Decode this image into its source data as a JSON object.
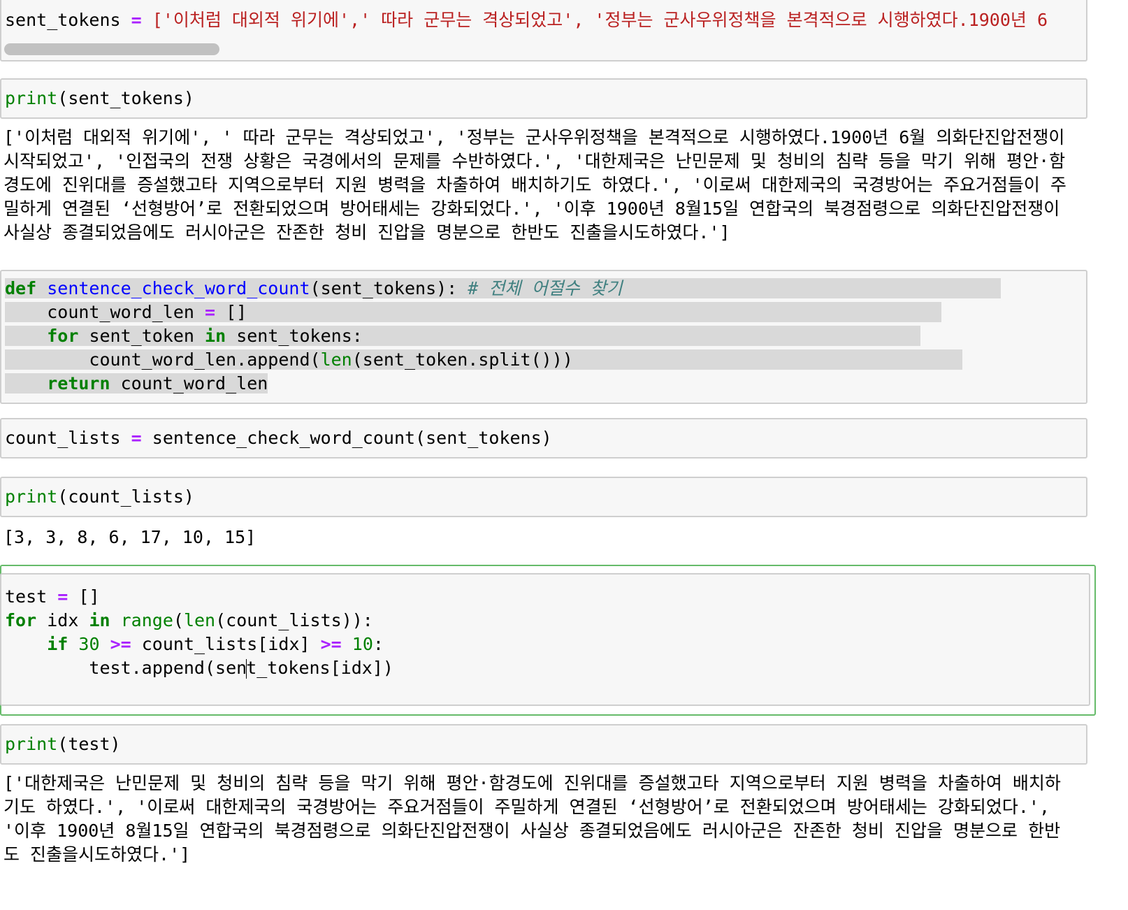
{
  "cell1": {
    "code_var": "sent_tokens",
    "eq": "=",
    "code_values": "['이처럼 대외적 위기에',' 따라 군무는 격상되었고', '정부는 군사우위정책을 본격적으로 시행하였다.1900년 6"
  },
  "cell2": {
    "code_fn": "print",
    "code_args": "(sent_tokens)",
    "output": "['이처럼 대외적 위기에', ' 따라 군무는 격상되었고', '정부는 군사우위정책을 본격적으로 시행하였다.1900년 6월 의화단진압전쟁이 시작되었고', '인접국의 전쟁 상황은 국경에서의 문제를 수반하였다.', '대한제국은 난민문제 및 청비의 침략 등을 막기 위해 평안·함경도에 진위대를 증설했고타 지역으로부터 지원 병력을 차출하여 배치하기도 하였다.', '이로써 대한제국의 국경방어는 주요거점들이 주밀하게 연결된 ‘선형방어’로 전환되었으며 방어태세는 강화되었다.', '이후 1900년 8월15일 연합국의 북경점령으로 의화단진압전쟁이 사실상 종결되었음에도 러시아군은 잔존한 청비 진압을 명분으로 한반도 진출을시도하였다.']"
  },
  "cell3": {
    "kw_def": "def",
    "fn_name": "sentence_check_word_count",
    "params": "(sent_tokens):",
    "comment": "# 전체 어절수 찾기",
    "l2_var": "count_word_len",
    "l2_eq": "=",
    "l2_val": "[]",
    "kw_for": "for",
    "l3_var": "sent_token",
    "kw_in": "in",
    "l3_iter": "sent_tokens:",
    "l4_a": "count_word_len.append(",
    "l4_len": "len",
    "l4_b": "(sent_token.split()))",
    "kw_return": "return",
    "l5_val": "count_word_len"
  },
  "cell4": {
    "var": "count_lists",
    "eq": "=",
    "rhs": "sentence_check_word_count(sent_tokens)"
  },
  "cell5": {
    "code_fn": "print",
    "code_args": "(count_lists)",
    "output": "[3, 3, 8, 6, 17, 10, 15]"
  },
  "cell6": {
    "l1_var": "test",
    "l1_eq": "=",
    "l1_val": "[]",
    "kw_for": "for",
    "l2_var": "idx",
    "kw_in": "in",
    "l2_range": "range",
    "l2_p1": "(",
    "l2_len": "len",
    "l2_p2": "(count_lists)):",
    "kw_if": "if",
    "l3_num1": "30",
    "l3_op1": ">=",
    "l3_mid": "count_lists[idx]",
    "l3_op2": ">=",
    "l3_num2": "10",
    "l3_colon": ":",
    "l4_a": "test.append(sen",
    "l4_b": "t_tokens[idx])"
  },
  "cell7": {
    "code_fn": "print",
    "code_args": "(test)",
    "output": "['대한제국은 난민문제 및 청비의 침략 등을 막기 위해 평안·함경도에 진위대를 증설했고타 지역으로부터 지원 병력을 차출하여 배치하기도 하였다.', '이로써 대한제국의 국경방어는 주요거점들이 주밀하게 연결된 ‘선형방어’로 전환되었으며 방어태세는 강화되었다.', '이후 1900년 8월15일 연합국의 북경점령으로 의화단진압전쟁이 사실상 종결되었음에도 러시아군은 잔존한 청비 진압을 명분으로 한반도 진출을시도하였다.']"
  },
  "colors": {
    "keyword": "#008000",
    "operator": "#aa22ff",
    "string": "#ba2121",
    "function": "#0000ff",
    "comment": "#408080",
    "selected_cell_border": "#66bb6a"
  }
}
